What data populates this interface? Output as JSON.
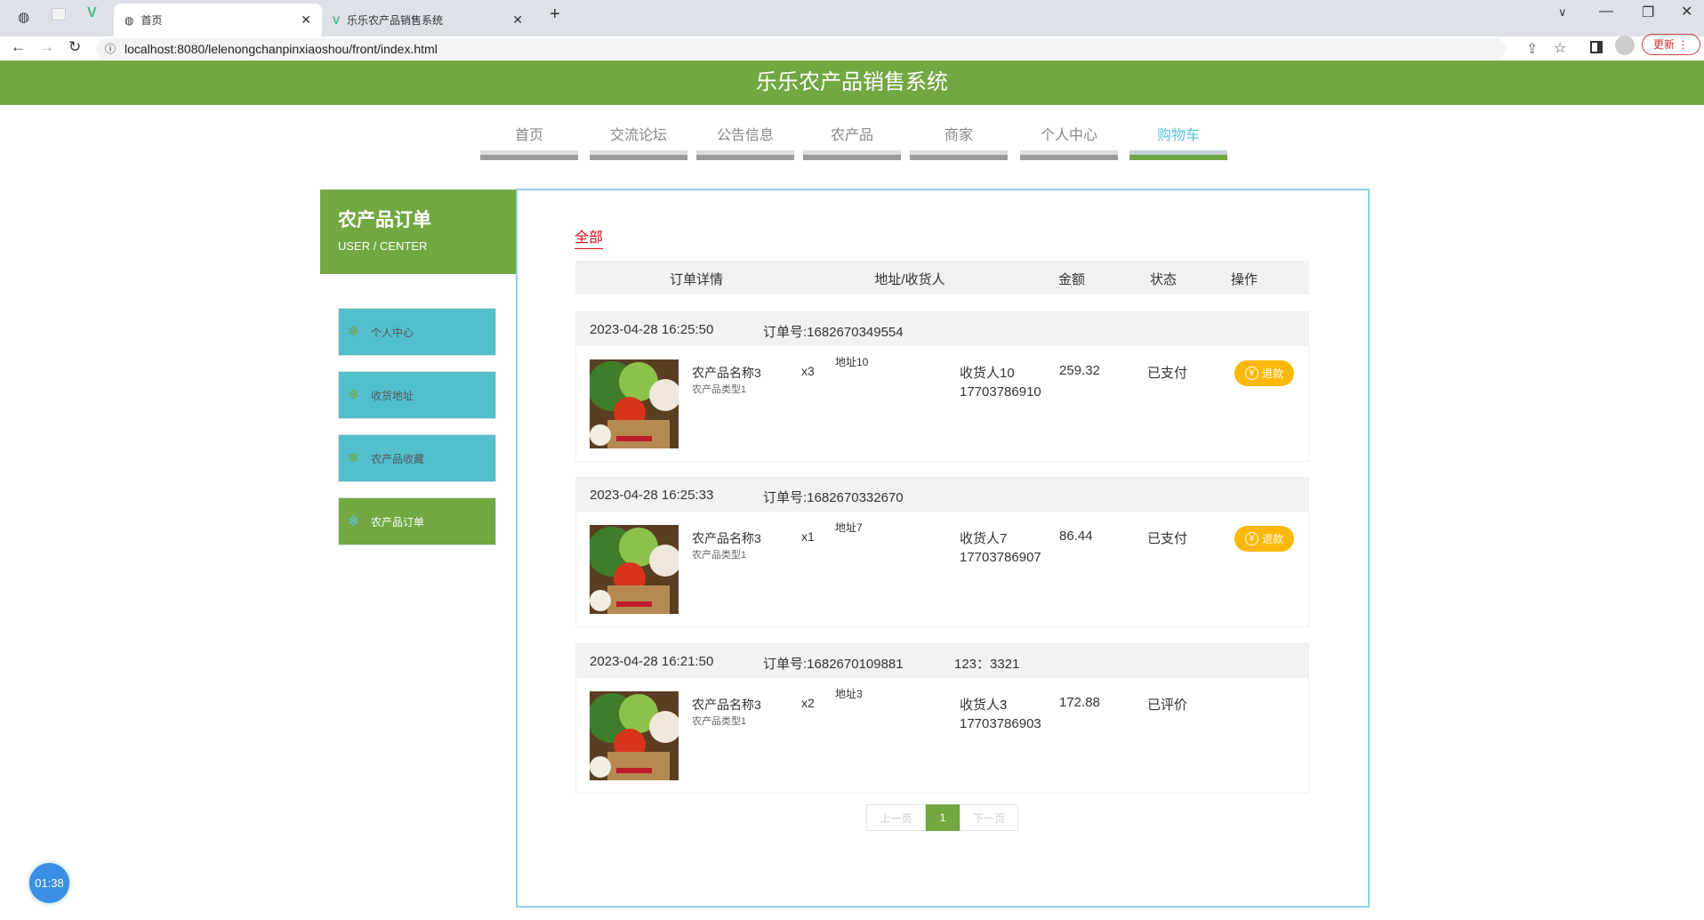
{
  "browser": {
    "tabs": [
      {
        "title": "首页"
      },
      {
        "title": "乐乐农产品销售系统"
      }
    ],
    "url": "localhost:8080/lelenongchanpinxiaoshou/front/index.html",
    "update_label": "更新"
  },
  "site": {
    "title": "乐乐农产品销售系统"
  },
  "nav": [
    {
      "label": "首页"
    },
    {
      "label": "交流论坛"
    },
    {
      "label": "公告信息"
    },
    {
      "label": "农产品"
    },
    {
      "label": "商家"
    },
    {
      "label": "个人中心"
    },
    {
      "label": "购物车"
    }
  ],
  "sidebar": {
    "title": "农产品订单",
    "subtitle": "USER / CENTER",
    "items": [
      {
        "label": "个人中心"
      },
      {
        "label": "收货地址"
      },
      {
        "label": "农产品收藏"
      },
      {
        "label": "农产品订单"
      }
    ]
  },
  "filter": {
    "all": "全部"
  },
  "table": {
    "headers": [
      "订单详情",
      "地址/收货人",
      "金额",
      "状态",
      "操作"
    ]
  },
  "orders": [
    {
      "time": "2023-04-28 16:25:50",
      "order_no": "订单号:1682670349554",
      "extra": "",
      "name": "农产品名称3",
      "type": "农产品类型1",
      "qty": "x3",
      "address": "地址10",
      "receiver": "收货人10",
      "phone": "17703786910",
      "amount": "259.32",
      "status": "已支付",
      "action": "退款"
    },
    {
      "time": "2023-04-28 16:25:33",
      "order_no": "订单号:1682670332670",
      "extra": "",
      "name": "农产品名称3",
      "type": "农产品类型1",
      "qty": "x1",
      "address": "地址7",
      "receiver": "收货人7",
      "phone": "17703786907",
      "amount": "86.44",
      "status": "已支付",
      "action": "退款"
    },
    {
      "time": "2023-04-28 16:21:50",
      "order_no": "订单号:1682670109881",
      "extra": "123：3321",
      "name": "农产品名称3",
      "type": "农产品类型1",
      "qty": "x2",
      "address": "地址3",
      "receiver": "收货人3",
      "phone": "17703786903",
      "amount": "172.88",
      "status": "已评价",
      "action": ""
    }
  ],
  "pagination": {
    "prev": "上一页",
    "current": "1",
    "next": "下一页"
  },
  "timer": "01:38"
}
